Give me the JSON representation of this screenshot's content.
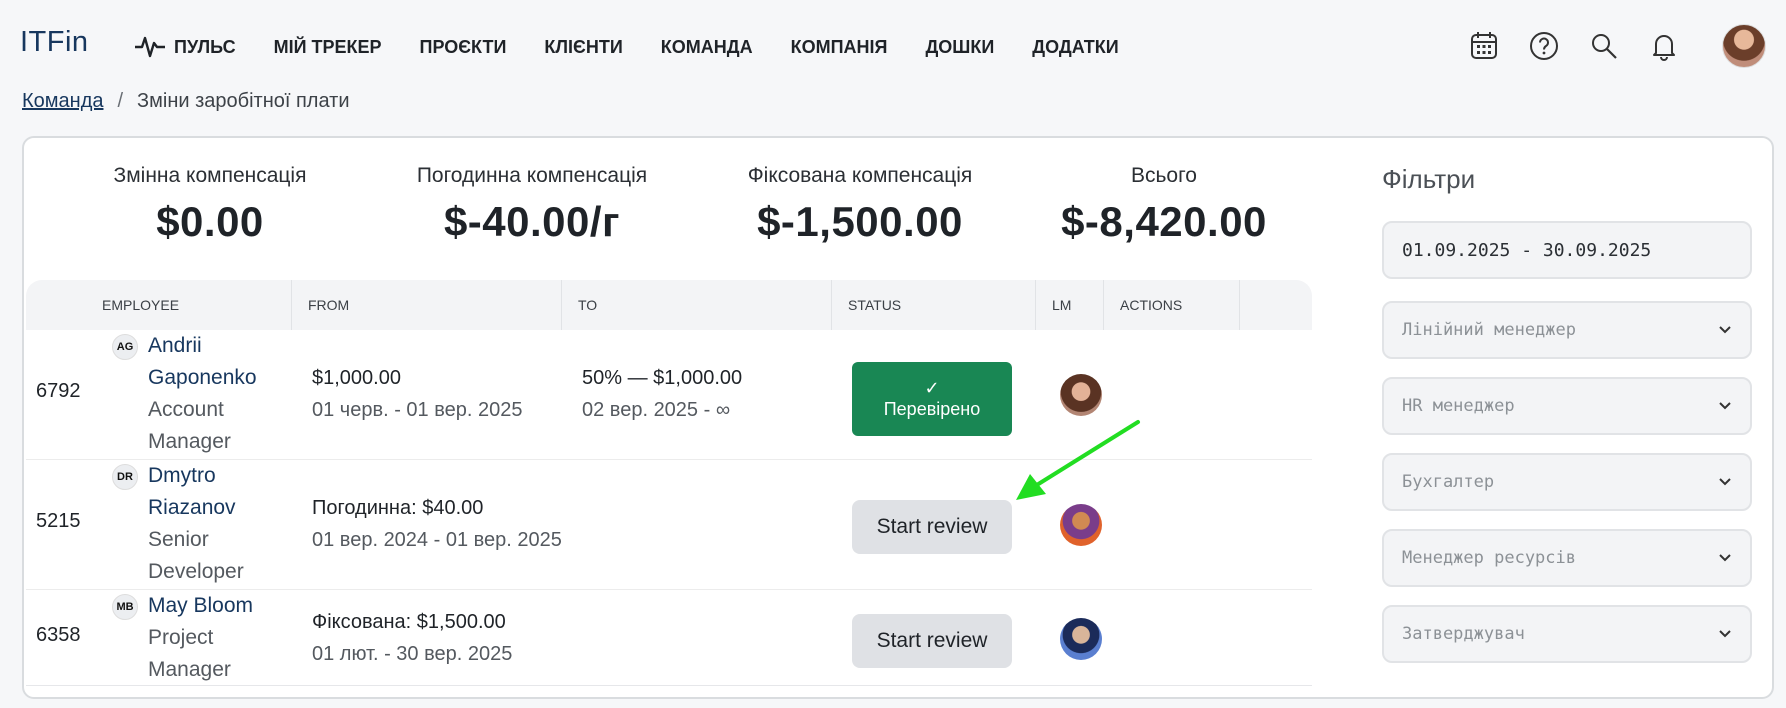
{
  "app": {
    "logo": "ITFin"
  },
  "nav": {
    "items": [
      {
        "label": "ПУЛЬС",
        "icon": "pulse-icon"
      },
      {
        "label": "МІЙ ТРЕКЕР"
      },
      {
        "label": "ПРОЄКТИ"
      },
      {
        "label": "КЛІЄНТИ"
      },
      {
        "label": "КОМАНДА"
      },
      {
        "label": "КОМПАНІЯ"
      },
      {
        "label": "ДОШКИ"
      },
      {
        "label": "ДОДАТКИ"
      }
    ],
    "icons": [
      "calendar-icon",
      "help-icon",
      "search-icon",
      "bell-icon"
    ]
  },
  "breadcrumb": {
    "link": "Команда",
    "separator": "/",
    "current": "Зміни заробітної плати"
  },
  "summary": [
    {
      "label": "Змінна компенсація",
      "value": "$0.00"
    },
    {
      "label": "Погодинна компенсація",
      "value": "$-40.00/г"
    },
    {
      "label": "Фіксована компенсація",
      "value": "$-1,500.00"
    },
    {
      "label": "Всього",
      "value": "$-8,420.00"
    }
  ],
  "table": {
    "headers": [
      "EMPLOYEE",
      "FROM",
      "TO",
      "STATUS",
      "LM",
      "ACTIONS"
    ],
    "rows": [
      {
        "id": "6792",
        "initials": "AG",
        "name_line1": "Andrii",
        "name_line2": "Gaponenko",
        "role_line1": "Account",
        "role_line2": "Manager",
        "from_main": "$1,000.00",
        "from_sub": "01 черв. - 01 вер. 2025",
        "to_main": "50% — $1,000.00",
        "to_sub": "02 вер. 2025 - ∞",
        "status_check": "✓",
        "status_label": "Перевірено"
      },
      {
        "id": "5215",
        "initials": "DR",
        "name_line1": "Dmytro",
        "name_line2": "Riazanov",
        "role_line1": "Senior",
        "role_line2": "Developer",
        "from_main": "Погодинна: $40.00",
        "from_sub": "01 вер. 2024 - 01 вер. 2025",
        "to_main": "",
        "to_sub": "",
        "status_label": "Start review"
      },
      {
        "id": "6358",
        "initials": "MB",
        "name_line1": "May Bloom",
        "role_line1": "Project",
        "role_line2": "Manager",
        "from_main": "Фіксована: $1,500.00",
        "from_sub": "01 лют. - 30 вер. 2025",
        "to_main": "",
        "to_sub": "",
        "status_label": "Start review"
      }
    ]
  },
  "filters": {
    "title": "Фільтри",
    "date_range": "01.09.2025 - 30.09.2025",
    "selects": [
      "Лінійний менеджер",
      "HR менеджер",
      "Бухгалтер",
      "Менеджер ресурсів",
      "Затверджувач"
    ]
  },
  "colors": {
    "brand": "#17375e",
    "verified": "#198754",
    "annotation_arrow": "#22dd22"
  }
}
